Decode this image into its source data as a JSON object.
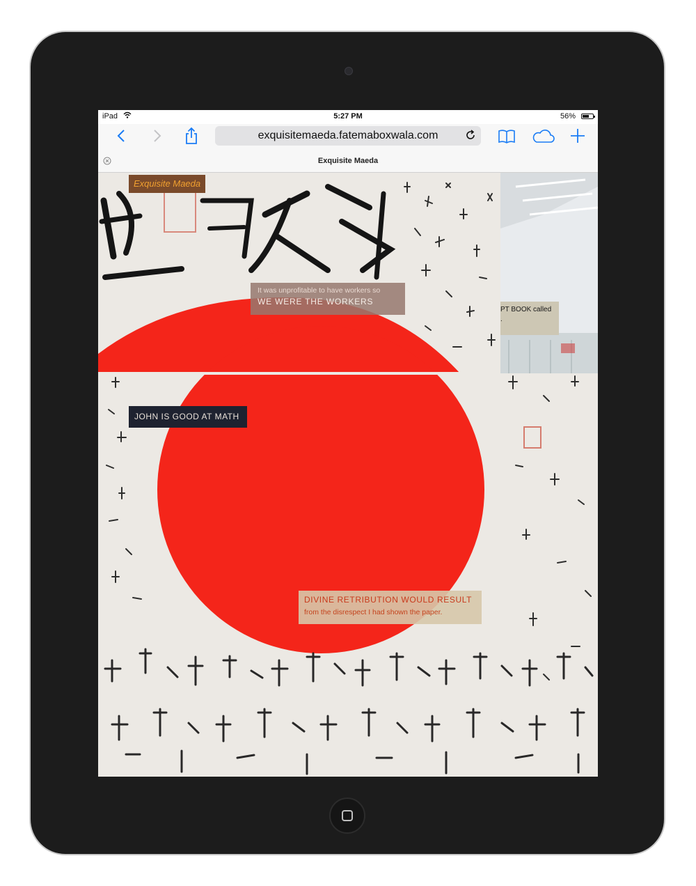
{
  "status": {
    "carrier": "iPad",
    "time": "5:27 PM",
    "battery": "56%",
    "battery_level": 0.56
  },
  "toolbar": {
    "url": "exquisitemaeda.fatemaboxwala.com"
  },
  "tab": {
    "title": "Exquisite Maeda"
  },
  "page": {
    "site_title": "Exquisite Maeda",
    "quote1_line1": "It was unprofitable to have workers so",
    "quote1_line2": "WE WERE THE WORKERS",
    "book_line1": "PT BOOK called",
    "book_line2": ".",
    "john": "JOHN IS GOOD AT MATH",
    "divine_line1": "DIVINE RETRIBUTION WOULD RESULT",
    "divine_line2": "from the disrespect I had shown the paper."
  },
  "colors": {
    "accent": "#1a7cf5",
    "flag_red": "#f4251a",
    "title_bg": "#7a4a2a",
    "title_text": "#f0a030"
  }
}
